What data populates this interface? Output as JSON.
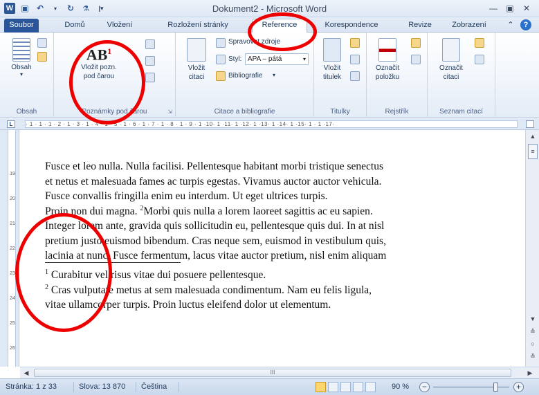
{
  "window": {
    "title": "Dokument2 - Microsoft Word",
    "app_icon": "word-logo",
    "controls": [
      "minimize",
      "maximize",
      "close"
    ]
  },
  "quick_access": [
    "save-icon",
    "undo-icon",
    "redo-icon",
    "format-painter-icon",
    "customize-icon"
  ],
  "tabs": [
    {
      "label": "Soubor",
      "type": "file"
    },
    {
      "label": "Domů"
    },
    {
      "label": "Vložení"
    },
    {
      "label": "Rozložení stránky"
    },
    {
      "label": "Reference",
      "active": true
    },
    {
      "label": "Korespondence"
    },
    {
      "label": "Revize"
    },
    {
      "label": "Zobrazení"
    }
  ],
  "ribbon": {
    "groups": [
      {
        "label": "Obsah",
        "buttons": [
          {
            "label": "Obsah"
          }
        ]
      },
      {
        "label": "Poznámky pod čarou",
        "buttons": [
          {
            "label": "Vložit pozn. pod čarou"
          }
        ]
      },
      {
        "label": "Citace a bibliografie",
        "buttons": [
          {
            "label": "Vložit citaci"
          },
          {
            "label": "Spravovat zdroje"
          },
          {
            "label": "Styl:"
          },
          {
            "label": "Bibliografie"
          }
        ],
        "style_value": "APA – pátá"
      },
      {
        "label": "Titulky",
        "buttons": [
          {
            "label": "Vložit titulek"
          }
        ]
      },
      {
        "label": "Rejstřík",
        "buttons": [
          {
            "label": "Označit položku"
          }
        ]
      },
      {
        "label": "Seznam citací",
        "buttons": [
          {
            "label": "Označit citaci"
          }
        ]
      }
    ]
  },
  "ruler": {
    "text": "· 1 · 1 · 1 · 2 · 1 · 3 · 1 · 4 · 1 · 5 · 1 · 6 · 1 · 7 · 1 · 8 · 1 · 9 · 1 ·10· 1 ·11· 1 ·12· 1 ·13· 1 ·14· 1 ·15· 1 · 1 ·17·",
    "corner": "L",
    "vertical_ticks": [
      "19",
      "20",
      "21",
      "22",
      "23",
      "24",
      "25",
      "26"
    ]
  },
  "document": {
    "lines": [
      "Fusce et leo nulla. Nulla facilisi. Pellentesque habitant morbi tristique senectus",
      "et netus et malesuada fames ac turpis egestas. Vivamus auctor auctor vehicula.",
      "Fusce convallis fringilla enim eu interdum. Ut eget ultrices turpis.",
      "Proin non dui magna. ",
      "Integer lorem ante, gravida quis sollicitudin eu, pellentesque quis dui. In at nisl",
      "pretium justo euismod bibendum. Cras neque sem, euismod in vestibulum quis,",
      "lacinia at nunc. Fusce fermentum, lacus vitae auctor pretium, nisl enim aliquam"
    ],
    "line4_ref": "2",
    "line4_rest": "Morbi quis nulla a lorem laoreet sagittis ac eu sapien.",
    "footnotes": [
      {
        "num": "1",
        "text": " Curabitur vel risus vitae dui posuere pellentesque."
      },
      {
        "num": "2",
        "text": " Cras vulputate metus at sem malesuada condimentum. Nam eu felis ligula,"
      },
      {
        "num": "",
        "text": "vitae ullamcorper turpis. Proin luctus eleifend dolor ut elementum."
      }
    ]
  },
  "scrollbar": {
    "h_thumb_grip": "III"
  },
  "status": {
    "page": "Stránka: 1 z 33",
    "words": "Slova: 13 870",
    "language": "Čeština",
    "zoom": "90 %",
    "zoom_fraction": 0.82,
    "zoom_minus": "−",
    "zoom_plus": "+"
  },
  "colors": {
    "accent": "#2a5699",
    "annotation": "#ee0000"
  }
}
